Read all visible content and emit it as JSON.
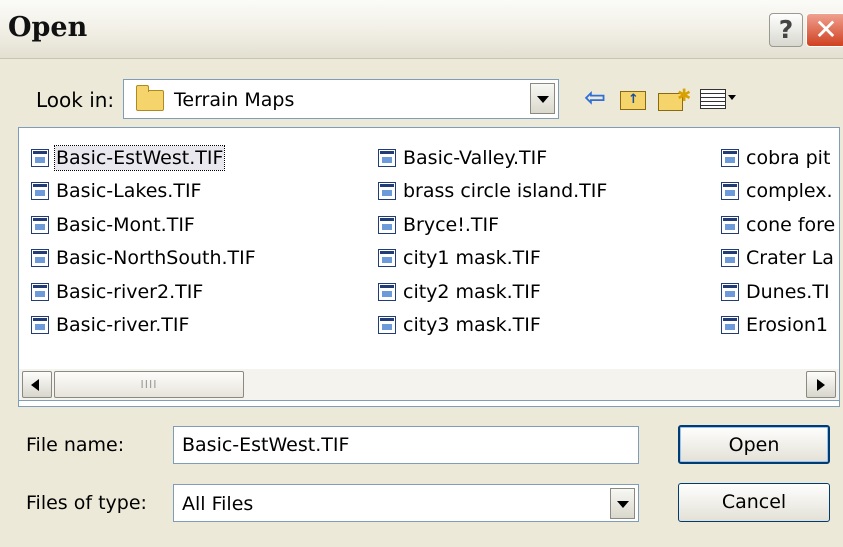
{
  "window": {
    "title": "Open"
  },
  "toolbar": {
    "look_in_label": "Look in:",
    "look_in_value": "Terrain Maps",
    "icons": [
      "back-icon",
      "up-folder-icon",
      "new-folder-icon",
      "views-menu-icon"
    ]
  },
  "files": {
    "selected": "Basic-EstWest.TIF",
    "columns": [
      [
        "Basic-EstWest.TIF",
        "Basic-Lakes.TIF",
        "Basic-Mont.TIF",
        "Basic-NorthSouth.TIF",
        "Basic-river2.TIF",
        "Basic-river.TIF"
      ],
      [
        "Basic-Valley.TIF",
        "brass circle island.TIF",
        "Bryce!.TIF",
        "city1 mask.TIF",
        "city2 mask.TIF",
        "city3 mask.TIF"
      ],
      [
        "cobra pit",
        "complex.",
        "cone fore",
        "Crater La",
        "Dunes.TI",
        "Erosion1"
      ]
    ],
    "scroll_thumb_grip": "IIII"
  },
  "form": {
    "file_name_label": "File name:",
    "file_name_value": "Basic-EstWest.TIF",
    "file_type_label": "Files of type:",
    "file_type_value": "All Files",
    "open_label": "Open",
    "cancel_label": "Cancel"
  },
  "colors": {
    "dialog_bg": "#ece9d8",
    "border": "#7f9db9",
    "close_red": "#d04020"
  }
}
